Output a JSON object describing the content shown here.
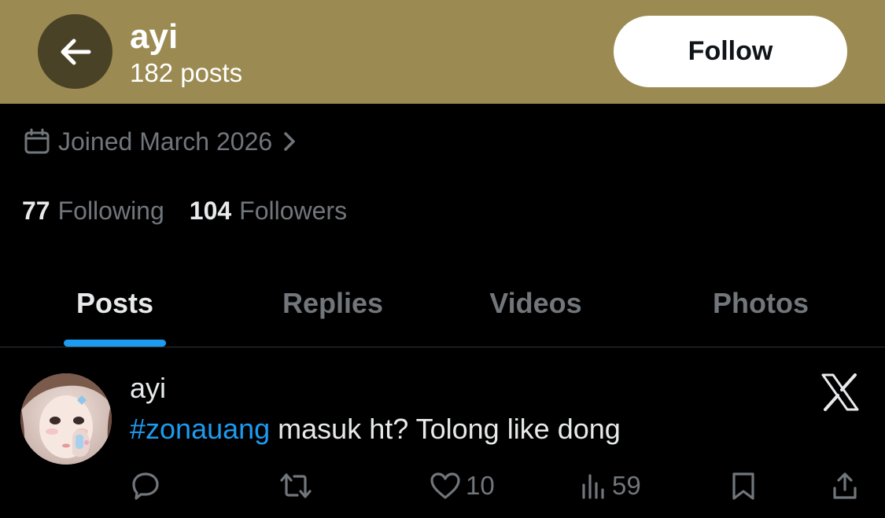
{
  "header": {
    "name": "ayi",
    "post_count": "182 posts",
    "follow_label": "Follow",
    "background_color": "#9b8b53"
  },
  "profile": {
    "joined": "Joined March 2026",
    "following_count": "77",
    "following_label": "Following",
    "followers_count": "104",
    "followers_label": "Followers"
  },
  "tabs": [
    {
      "label": "Posts",
      "active": true
    },
    {
      "label": "Replies",
      "active": false
    },
    {
      "label": "Videos",
      "active": false
    },
    {
      "label": "Photos",
      "active": false
    }
  ],
  "post": {
    "author": "ayi",
    "hashtag": "#zonauang",
    "text": " masuk ht? Tolong like dong",
    "likes": "10",
    "views": "59"
  },
  "icons": {
    "back": "arrow-left-icon",
    "joined": "calendar-icon",
    "joined_chevron": "chevron-right-icon",
    "x_logo": "x-logo-icon",
    "reply": "reply-icon",
    "repost": "repost-icon",
    "like": "heart-icon",
    "views": "views-icon",
    "bookmark": "bookmark-icon",
    "share": "share-icon"
  },
  "colors": {
    "accent": "#1d9bf0",
    "muted": "#71767b",
    "text": "#e7e9ea"
  }
}
